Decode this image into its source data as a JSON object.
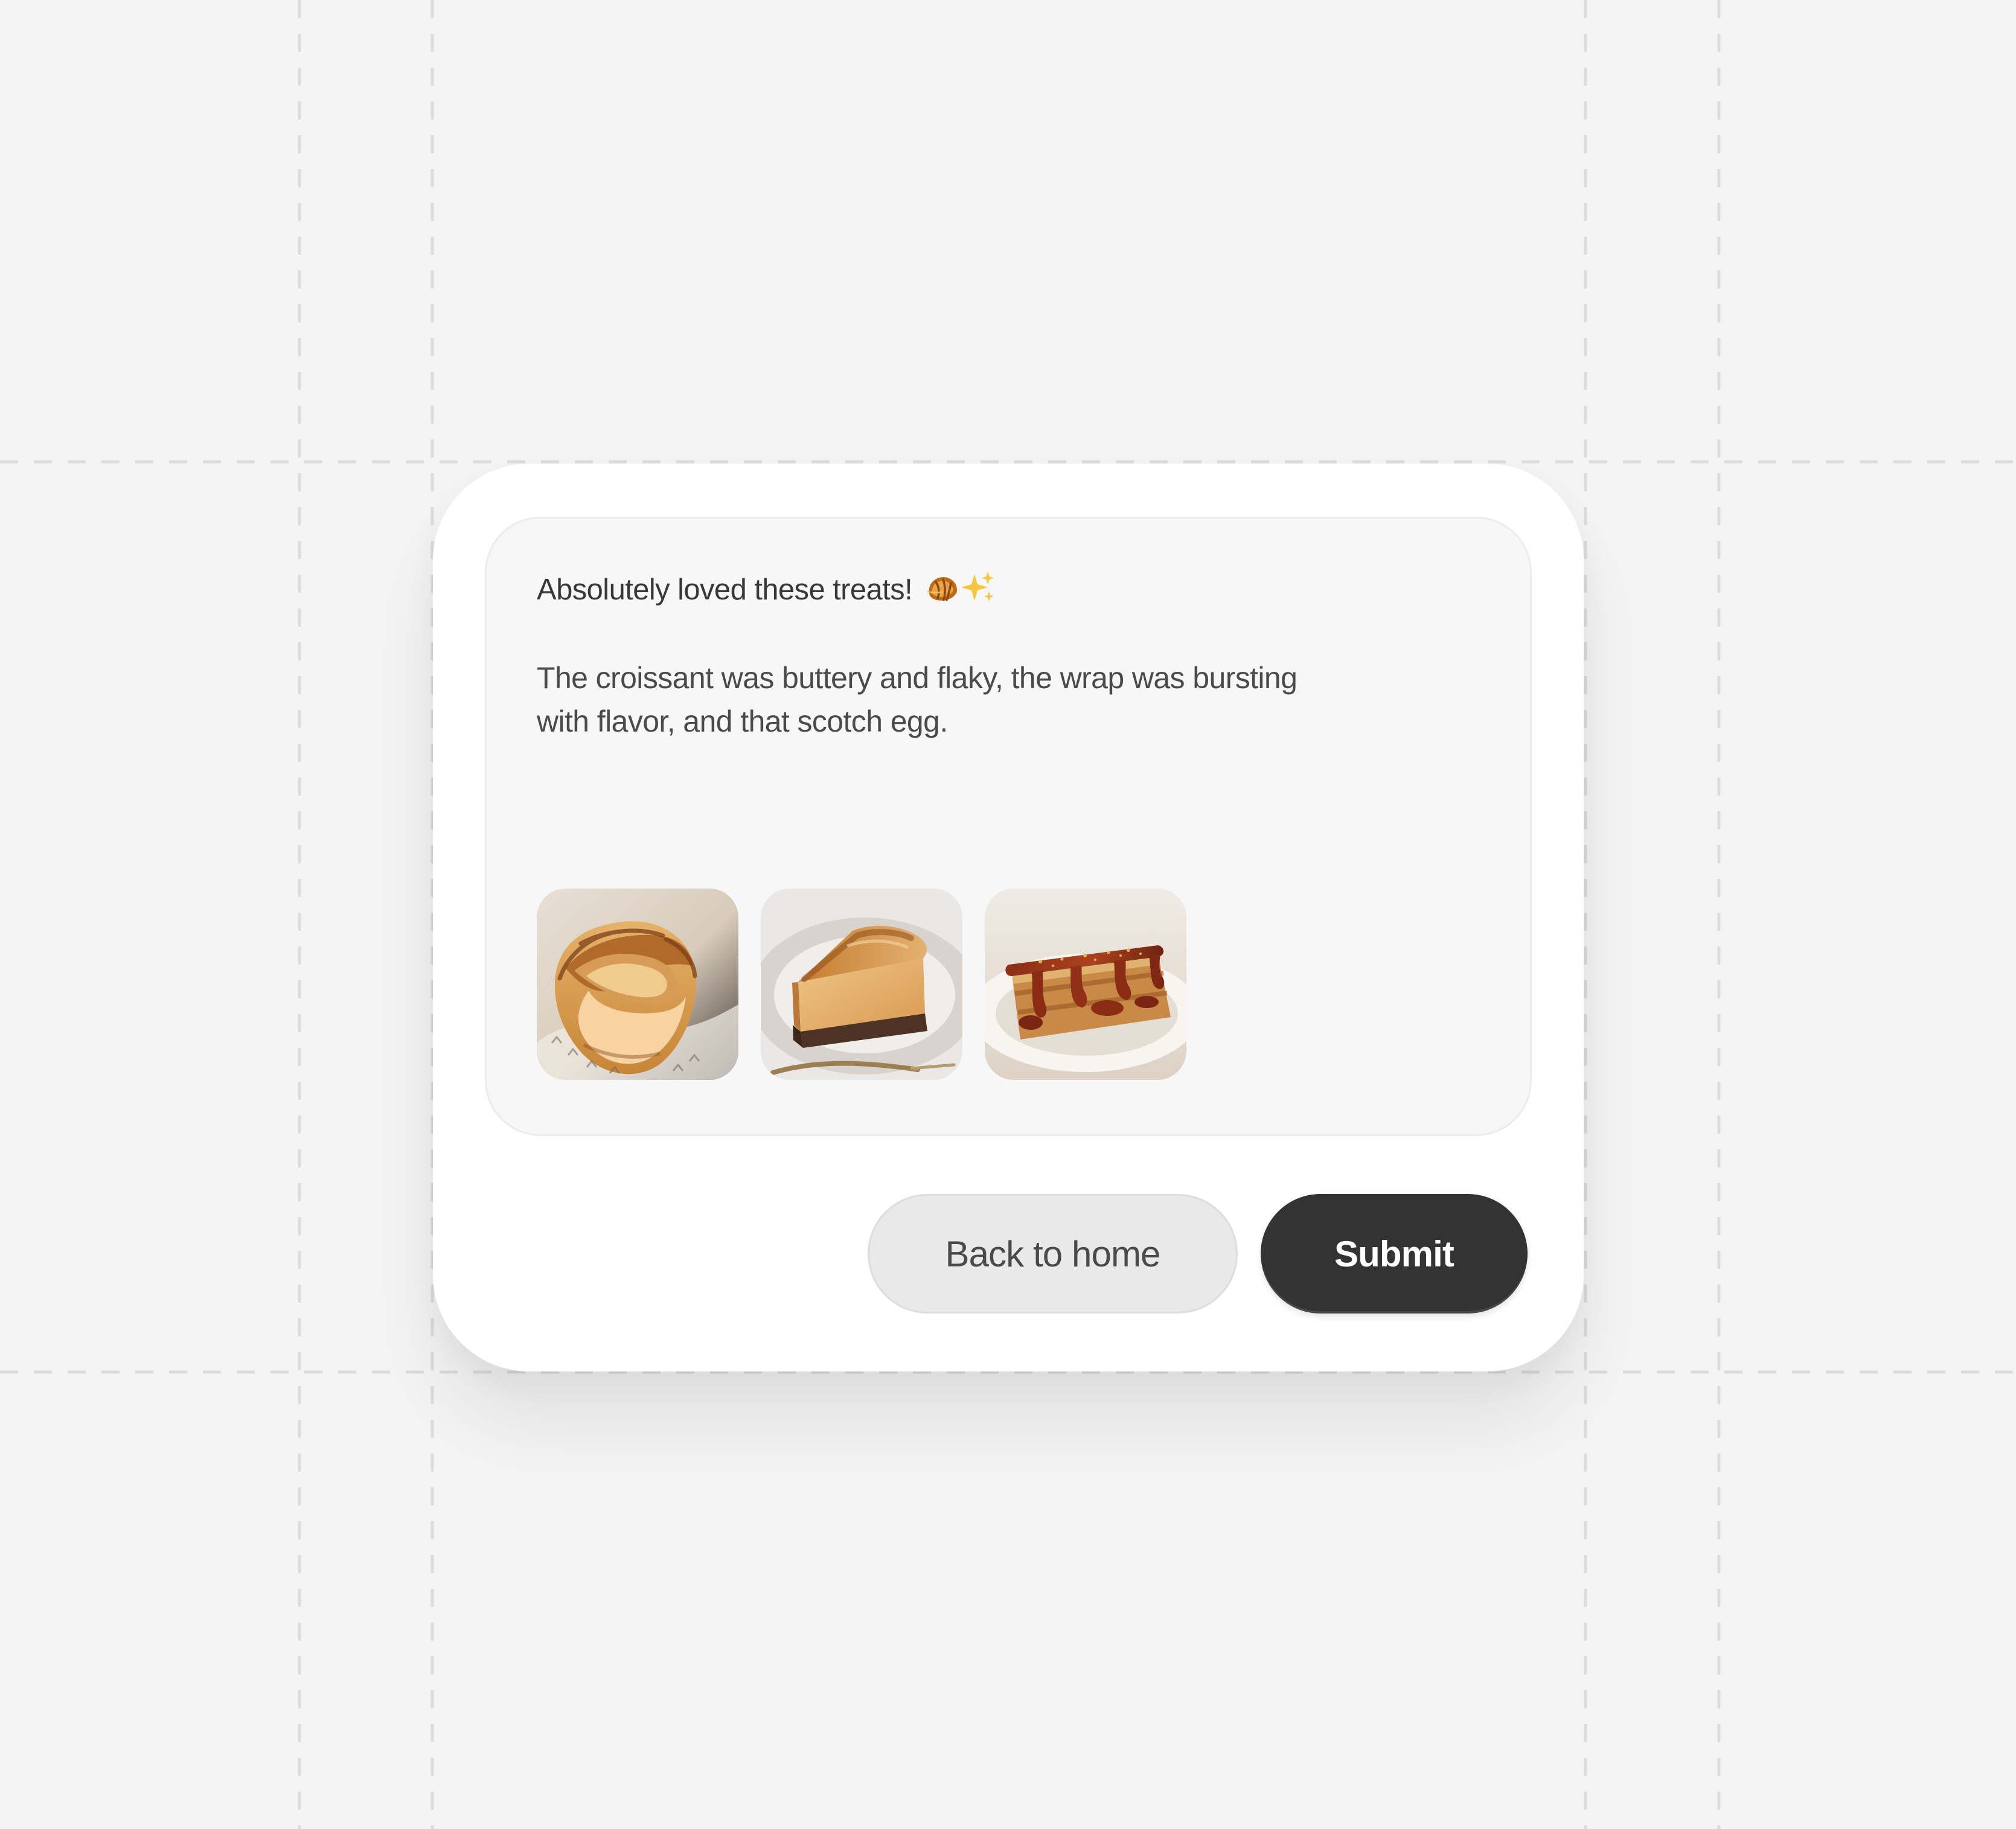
{
  "review": {
    "title": "Absolutely loved these treats!",
    "title_emoji": "🥐✨",
    "body": "The croissant was buttery and flaky, the wrap was bursting with flavor, and that scotch egg.",
    "images": [
      {
        "name": "custard-tart-photo"
      },
      {
        "name": "cheesecake-slice-photo"
      },
      {
        "name": "caramel-cake-photo"
      }
    ]
  },
  "actions": {
    "back_label": "Back to home",
    "submit_label": "Submit"
  },
  "colors": {
    "background": "#f4f4f4",
    "card": "#ffffff",
    "message_box": "#f7f7f7",
    "primary_button": "#333333",
    "secondary_button": "#e9e9e9"
  }
}
